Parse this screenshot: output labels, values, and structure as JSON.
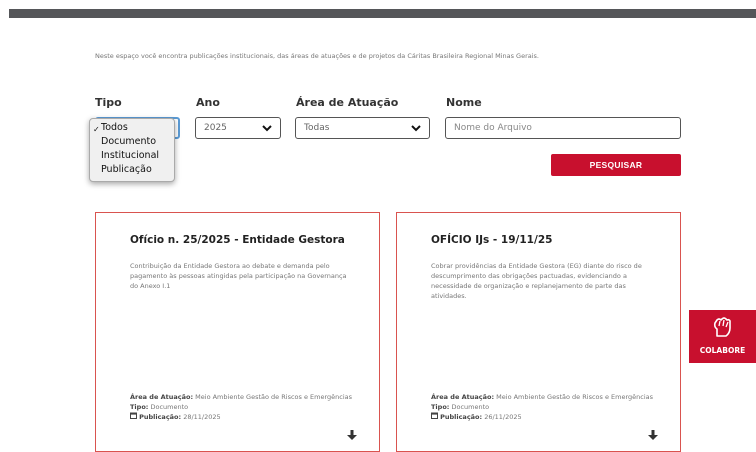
{
  "intro": "Neste espaço você encontra publicações institucionais, das áreas de atuações e de projetos da Cáritas Brasileira Regional Minas Gerais.",
  "filters": {
    "tipo": {
      "label": "Tipo",
      "options": [
        "Todos",
        "Documento",
        "Institucional",
        "Publicação"
      ],
      "selected": "Todos"
    },
    "ano": {
      "label": "Ano",
      "value": "2025"
    },
    "area": {
      "label": "Área de Atuação",
      "value": "Todas"
    },
    "nome": {
      "label": "Nome",
      "placeholder": "Nome do Arquivo"
    }
  },
  "search_button": "PESQUISAR",
  "cards": [
    {
      "title": "Ofício n. 25/2025 - Entidade Gestora",
      "description": "Contribuição da Entidade Gestora ao debate e demanda pelo pagamento às pessoas atingidas pela participação na Governança do Anexo I.1",
      "area_label": "Área de Atuação:",
      "area": "Meio Ambiente Gestão de Riscos e Emergências",
      "tipo_label": "Tipo:",
      "tipo": "Documento",
      "pub_label": "Publicação:",
      "pub": "28/11/2025"
    },
    {
      "title": "OFÍCIO IJs - 19/11/25",
      "description": "Cobrar providências da Entidade Gestora (EG) diante do risco de descumprimento das obrigações pactuadas, evidenciando a necessidade de organização e replanejamento de parte das atividades.",
      "area_label": "Área de Atuação:",
      "area": "Meio Ambiente Gestão de Riscos e Emergências",
      "tipo_label": "Tipo:",
      "tipo": "Documento",
      "pub_label": "Publicação:",
      "pub": "26/11/2025"
    }
  ],
  "colabore": "COLABORE",
  "icons": {
    "calendar": "calendar-icon",
    "download": "download-icon",
    "chevron": "chevron-down-icon",
    "check": "check-icon",
    "colabore": "fist-icon"
  },
  "colors": {
    "accent": "#c8102e",
    "topbar": "#555659",
    "card_border": "#d9534f"
  }
}
